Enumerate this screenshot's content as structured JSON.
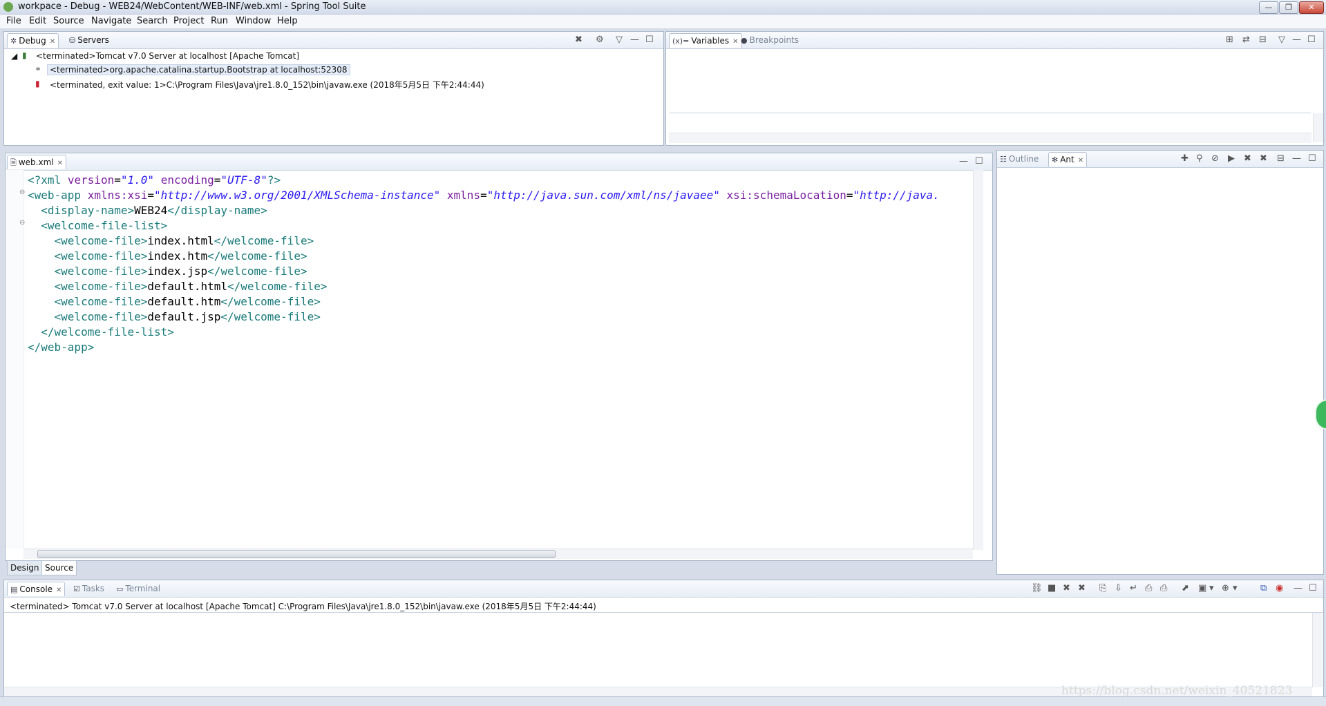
{
  "window": {
    "title": "workpace - Debug - WEB24/WebContent/WEB-INF/web.xml - Spring Tool Suite",
    "controls": {
      "minimize": "—",
      "restore": "❐",
      "close": "✕"
    }
  },
  "menu": [
    "File",
    "Edit",
    "Source",
    "Navigate",
    "Search",
    "Project",
    "Run",
    "Window",
    "Help"
  ],
  "debug_view": {
    "tabs": [
      {
        "label": "Debug",
        "icon": "bug-icon",
        "active": true
      },
      {
        "label": "Servers",
        "icon": "servers-icon",
        "active": false
      }
    ],
    "tree": [
      "<terminated>Tomcat v7.0 Server at localhost [Apache Tomcat]",
      "<terminated>org.apache.catalina.startup.Bootstrap at localhost:52308",
      "<terminated, exit value: 1>C:\\Program Files\\Java\\jre1.8.0_152\\bin\\javaw.exe (2018年5月5日 下午2:44:44)"
    ]
  },
  "variables_view": {
    "tabs": [
      {
        "label": "Variables",
        "icon": "variables-icon",
        "active": true
      },
      {
        "label": "Breakpoints",
        "icon": "breakpoints-icon",
        "active": false
      }
    ]
  },
  "editor": {
    "tab_label": "web.xml",
    "code": {
      "l1_pi_open": "<?xml",
      "l1_attr1": "version",
      "l1_val1": "\"1.0\"",
      "l1_attr2": "encoding",
      "l1_val2": "\"UTF-8\"",
      "l1_pi_close": "?>",
      "l2_tag": "<web-app",
      "l2_attr1": "xmlns:xsi",
      "l2_val1": "\"http://www.w3.org/2001/XMLSchema-instance\"",
      "l2_attr2": "xmlns",
      "l2_val2": "\"http://java.sun.com/xml/ns/javaee\"",
      "l2_attr3": "xsi:schemaLocation",
      "l2_val3": "\"http://java.",
      "display_open": "<display-name>",
      "display_text": "WEB24",
      "display_close": "</display-name>",
      "wfl_open": "<welcome-file-list>",
      "wf_open": "<welcome-file>",
      "wf_close": "</welcome-file>",
      "welcome_files": [
        "index.html",
        "index.htm",
        "index.jsp",
        "default.html",
        "default.htm",
        "default.jsp"
      ],
      "wfl_close": "</welcome-file-list>",
      "webapp_close": "</web-app>"
    },
    "bottom_tabs": [
      {
        "label": "Design",
        "active": false
      },
      {
        "label": "Source",
        "active": true
      }
    ]
  },
  "outline_view": {
    "tabs": [
      {
        "label": "Outline",
        "icon": "outline-icon",
        "active": false
      },
      {
        "label": "Ant",
        "icon": "ant-icon",
        "active": true
      }
    ]
  },
  "console_view": {
    "tabs": [
      {
        "label": "Console",
        "icon": "console-icon",
        "active": true
      },
      {
        "label": "Tasks",
        "icon": "tasks-icon",
        "active": false
      },
      {
        "label": "Terminal",
        "icon": "terminal-icon",
        "active": false
      }
    ],
    "output": "<terminated> Tomcat v7.0 Server at localhost [Apache Tomcat] C:\\Program Files\\Java\\jre1.8.0_152\\bin\\javaw.exe (2018年5月5日 下午2:44:44)"
  },
  "watermark": "https://blog.csdn.net/weixin_40521823",
  "colors": {
    "xml_tag": "#1a7a7a",
    "xml_attr": "#7a1fa0",
    "xml_value": "#2a1af0",
    "panel_border": "#a8b6c8",
    "chrome_bg": "#d6dde8"
  }
}
